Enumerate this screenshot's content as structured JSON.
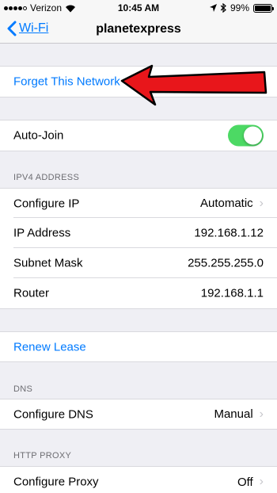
{
  "status_bar": {
    "carrier": "Verizon",
    "time": "10:45 AM",
    "battery": "99%",
    "battery_level": 0.99
  },
  "nav": {
    "back_label": "Wi-Fi",
    "title": "planetexpress"
  },
  "actions": {
    "forget_network": "Forget This Network",
    "renew_lease": "Renew Lease"
  },
  "auto_join": {
    "label": "Auto-Join",
    "enabled": true,
    "on_color": "#4cd964"
  },
  "ipv4": {
    "header": "IPV4 ADDRESS",
    "rows": [
      {
        "label": "Configure IP",
        "value": "Automatic"
      },
      {
        "label": "IP Address",
        "value": "192.168.1.12"
      },
      {
        "label": "Subnet Mask",
        "value": "255.255.255.0"
      },
      {
        "label": "Router",
        "value": "192.168.1.1"
      }
    ]
  },
  "dns": {
    "header": "DNS",
    "label": "Configure DNS",
    "value": "Manual"
  },
  "http_proxy": {
    "header": "HTTP PROXY",
    "label": "Configure Proxy",
    "value": "Off"
  },
  "colors": {
    "accent": "#007aff",
    "arrow": "#e8161b",
    "background": "#efeff4"
  }
}
